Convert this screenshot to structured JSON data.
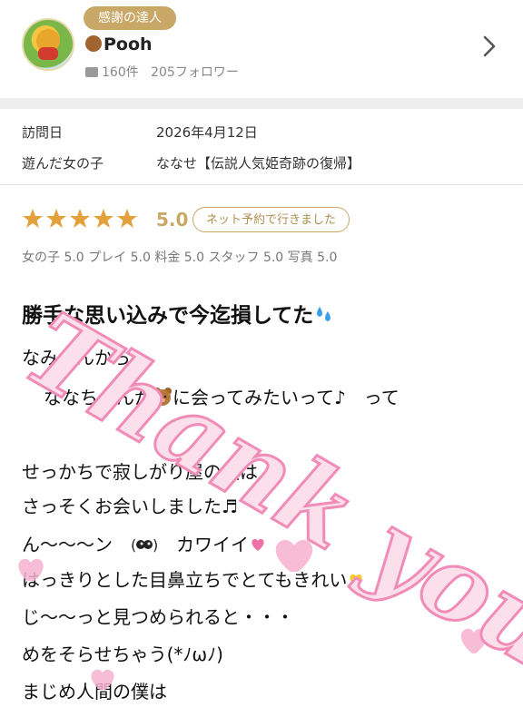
{
  "profile": {
    "badge": "感謝の達人",
    "name": "Pooh",
    "review_count": "160件",
    "followers": "205フォロワー"
  },
  "visit": {
    "date_label": "訪問日",
    "date_value": "2026年4月12日",
    "girl_label": "遊んだ女の子",
    "girl_value": "ななせ【伝説人気姫奇跡の復帰】"
  },
  "rating": {
    "stars": 5,
    "score": "5.0",
    "booking_badge": "ネット予約で行きました",
    "subscores": "女の子 5.0 プレイ 5.0 料金 5.0 スタッフ 5.0 写真 5.0"
  },
  "review": {
    "title": "勝手な思い込みで今迄損してた",
    "lines": [
      "なみさんから",
      "ななちゃんが",
      "に会ってみたいって♪　って",
      "せっかちで寂しがり屋の僕は",
      "さっそくお会いしました",
      "ん〜〜〜ン",
      "カワイイ",
      "はっきりとした目鼻立ちでとてもきれい",
      "じ〜〜っと見つめられると・・・",
      "めをそらせちゃう(*ﾉωﾉ)",
      "まじめ人間の僕は"
    ]
  },
  "watermark": {
    "text": "Thank you"
  },
  "colors": {
    "gold": "#c9a867",
    "star": "#e2a13a",
    "pink": "#f4a6c8"
  }
}
